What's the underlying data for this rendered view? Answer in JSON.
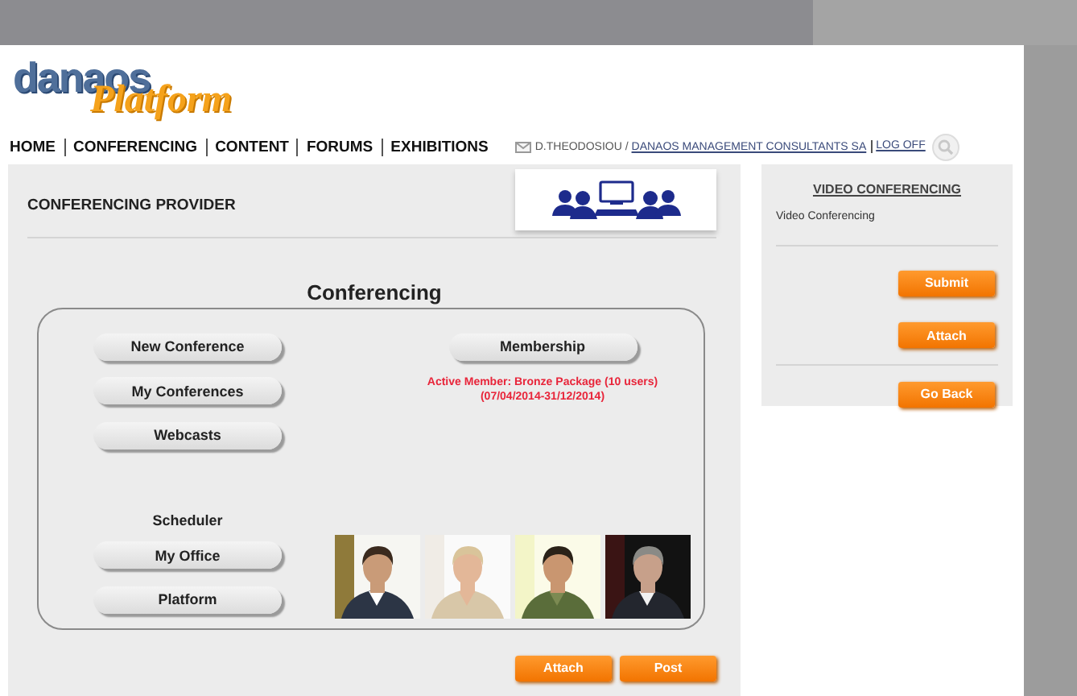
{
  "logo": {
    "word": "danaos",
    "script": "Platform"
  },
  "nav": {
    "items": [
      "HOME",
      "CONFERENCING",
      "CONTENT",
      "FORUMS",
      "EXHIBITIONS"
    ],
    "user": "D.THEODOSIOU /",
    "company": "DANAOS MANAGEMENT CONSULTANTS SA",
    "logoff": "LOG OFF"
  },
  "main": {
    "title": "CONFERENCING PROVIDER",
    "heading": "Conferencing",
    "left_buttons": [
      "New Conference",
      "My Conferences",
      "Webcasts"
    ],
    "membership_button": "Membership",
    "membership_status": "Active Member: Bronze Package (10 users)",
    "membership_period": "(07/04/2014-31/12/2014)",
    "scheduler": {
      "title": "Scheduler",
      "buttons": [
        "My Office",
        "Platform"
      ]
    },
    "photos": [
      {
        "kind": "picture"
      },
      {
        "kind": "picture"
      },
      {
        "kind": "picture"
      },
      {
        "kind": "picture"
      }
    ],
    "actions": [
      "Attach",
      "Post"
    ]
  },
  "sidebar": {
    "title": "VIDEO CONFERENCING",
    "text": "Video Conferencing",
    "buttons": [
      "Submit",
      "Attach"
    ],
    "back_button": "Go Back"
  }
}
